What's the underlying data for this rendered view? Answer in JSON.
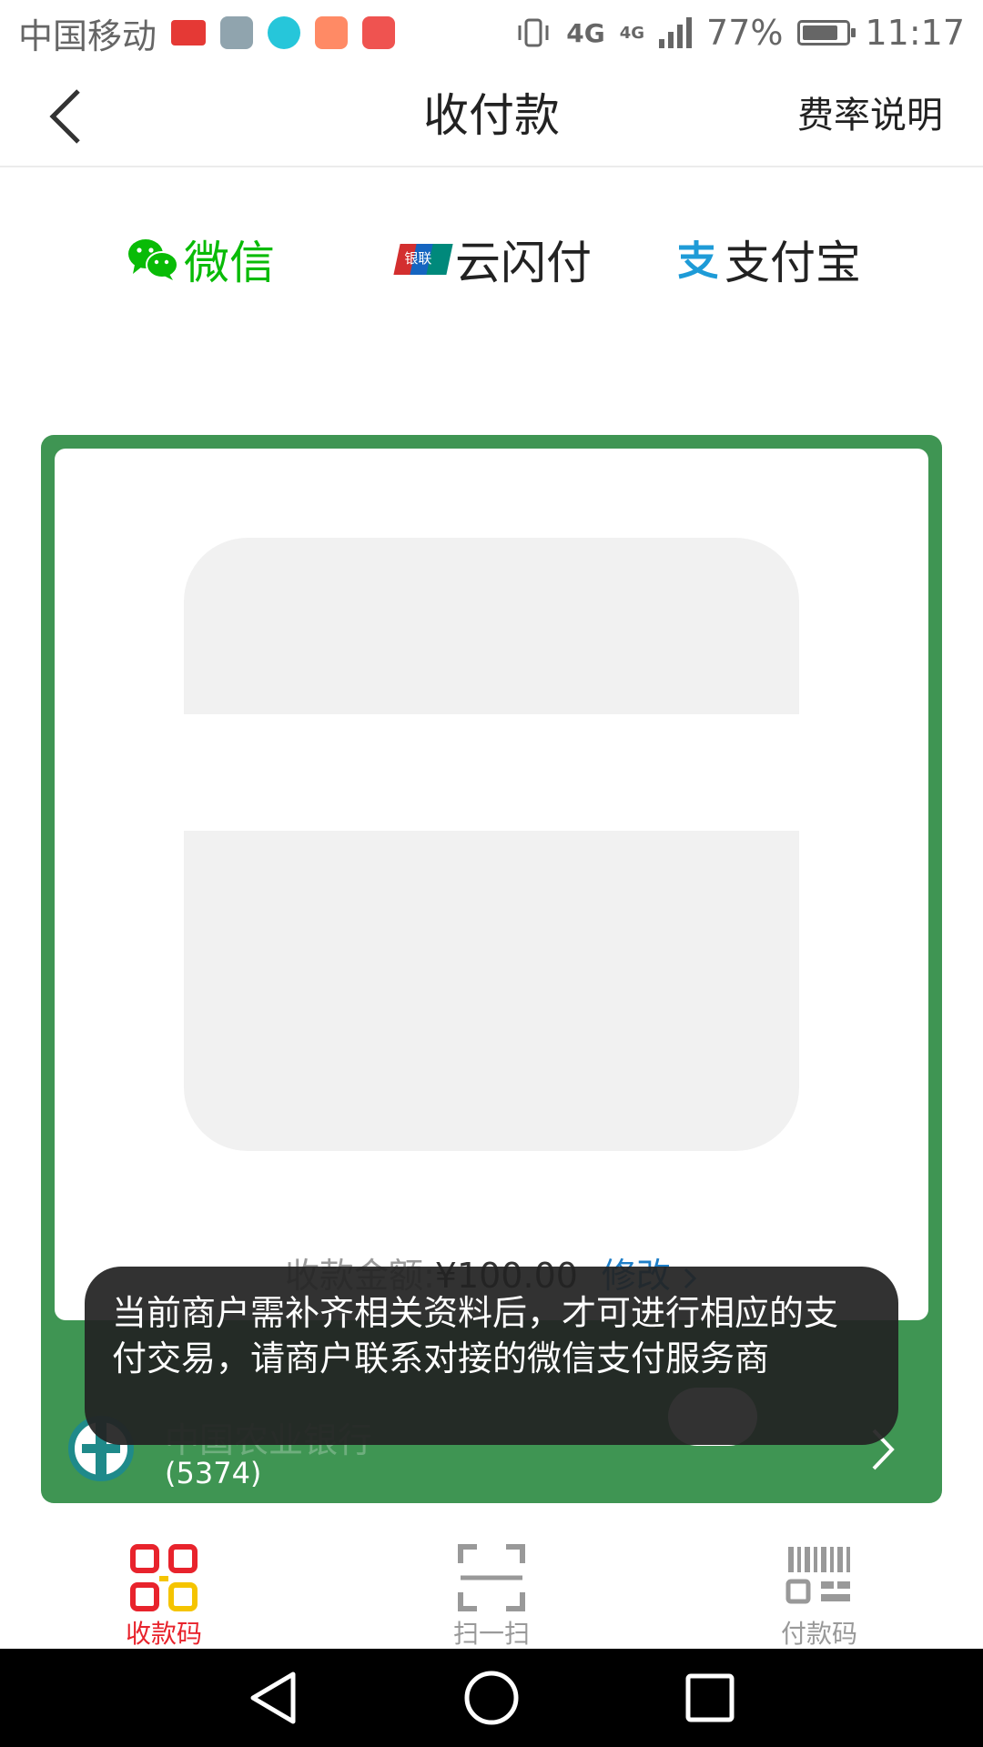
{
  "status_bar": {
    "carrier": "中国移动",
    "network": "4G",
    "network2": "4G",
    "battery": "77%",
    "time": "11:17",
    "notification_icons": [
      "toutiao-icon",
      "gallery-icon",
      "camera-icon",
      "app-icon",
      "cloud-icon"
    ]
  },
  "nav": {
    "title": "收付款",
    "rate_link": "费率说明"
  },
  "pay_tabs": [
    {
      "label": "微信",
      "icon": "wechat-icon",
      "selected": true,
      "color": "#09bb07"
    },
    {
      "label": "云闪付",
      "icon": "unionpay-icon",
      "selected": false,
      "logo_text": "银联"
    },
    {
      "label": "支付宝",
      "icon": "alipay-icon",
      "selected": false,
      "color": "#1677ff"
    }
  ],
  "card": {
    "amount_label": "收款金额:",
    "amount_value": "¥100.00",
    "modify": "修改",
    "bank_name": "中国农业银行",
    "bank_tail": "(5374)",
    "accent": "#3f9553"
  },
  "toast": {
    "message": "当前商户需补齐相关资料后，才可进行相应的支付交易，请商户联系对接的微信支付服务商"
  },
  "bottom_tabs": [
    {
      "label": "收款码",
      "icon": "qr-code-icon",
      "selected": true
    },
    {
      "label": "扫一扫",
      "icon": "scan-icon",
      "selected": false
    },
    {
      "label": "付款码",
      "icon": "barcode-icon",
      "selected": false
    }
  ]
}
